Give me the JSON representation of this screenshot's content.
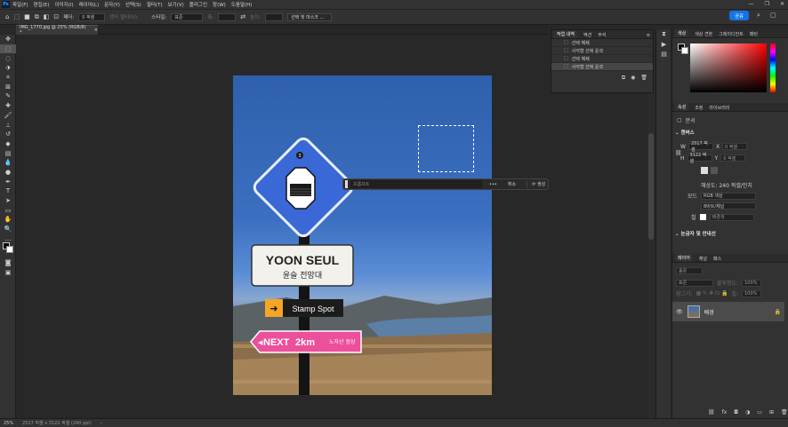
{
  "menu": {
    "logo": "Ps",
    "items": [
      "파일(F)",
      "편집(E)",
      "이미지(I)",
      "레이어(L)",
      "문자(Y)",
      "선택(S)",
      "필터(T)",
      "보기(V)",
      "플러그인",
      "창(W)",
      "도움말(H)"
    ]
  },
  "options": {
    "feather_label": "페더:",
    "feather_value": "0 픽셀",
    "antialias_label": "앤티 앨리어스",
    "style_label": "스타일:",
    "style_value": "표준",
    "width_label": "폭:",
    "height_label": "높이:",
    "select_mask_button": "선택 및 마스크 ...",
    "share_button": "공유"
  },
  "document": {
    "tab_title": "IMG_1770.jpg @ 25% (RGB/8) *",
    "close": "×"
  },
  "artwork": {
    "diamond_number": "3",
    "sign_title": "YOON SEUL",
    "sign_subtitle": "윤슬 전망대",
    "stamp_text": "Stamp Spot",
    "next_text": "NEXT",
    "distance_text": "2km",
    "destination_text": "노자산 정상"
  },
  "contextual_bar": {
    "prompt_placeholder": "프롬프트",
    "more": "•••",
    "cancel": "취소",
    "generate": "생성"
  },
  "history_panel": {
    "tabs": [
      "작업 내역",
      "액션",
      "주석"
    ],
    "items": [
      {
        "label": "선택 해제",
        "selected": false
      },
      {
        "label": "사각형 선택 윤곽",
        "selected": false
      },
      {
        "label": "선택 해제",
        "selected": false
      },
      {
        "label": "사각형 선택 윤곽",
        "selected": true
      }
    ]
  },
  "color_panel": {
    "tabs": [
      "색상",
      "색상 견본",
      "그레이디언트",
      "패턴"
    ],
    "accent": "#ff0000"
  },
  "properties_panel": {
    "tabs": [
      "속성",
      "조정",
      "라이브러리"
    ],
    "doc_label": "문서",
    "canvas_section": "캔버스",
    "w_label": "W",
    "w_value": "2517 픽셀",
    "x_label": "X",
    "x_placeholder": "0 픽셀",
    "h_label": "H",
    "h_value": "3122 픽셀",
    "y_label": "Y",
    "y_placeholder": "0 픽셀",
    "resolution": "해상도: 240 픽셀/인치",
    "mode_label": "모드",
    "mode_value": "RGB 색상",
    "depth_value": "8비트/채널",
    "fill_label": "칠",
    "fill_value": "배경색",
    "rulers_section": "눈금자 및 안내선"
  },
  "layers_panel": {
    "tabs": [
      "레이어",
      "채널",
      "패스"
    ],
    "kind_placeholder": "종류",
    "blend_mode": "표준",
    "opacity_label": "불투명도:",
    "opacity_value": "100%",
    "lock_label": "잠그기:",
    "fill_label": "칠:",
    "fill_value": "100%",
    "layer_name": "배경"
  },
  "status": {
    "zoom": "25%",
    "doc_info": "2517 픽셀 x 3122 픽셀 (240 ppi)"
  }
}
